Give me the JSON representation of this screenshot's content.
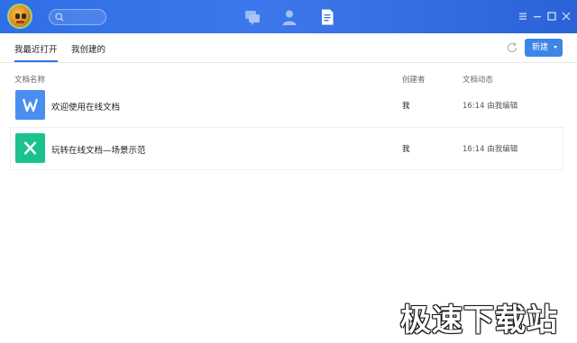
{
  "colors": {
    "titlebar": "#2f6fe6",
    "accent": "#2d73e8",
    "button": "#3d86e8",
    "word_icon": "#4a8ff0",
    "sheet_icon": "#1cc28e"
  },
  "titlebar": {
    "avatar_icon": "user-avatar",
    "search_placeholder": "",
    "nav_icons": [
      "chat-icon",
      "contacts-icon",
      "document-icon"
    ],
    "active_nav": "document-icon",
    "window_controls": [
      "menu-icon",
      "minimize-icon",
      "maximize-icon",
      "close-icon"
    ]
  },
  "tabs": {
    "recent": "我最近打开",
    "created": "我创建的",
    "active": "recent"
  },
  "toolbar": {
    "new_label": "新建",
    "refresh_icon": "refresh-icon"
  },
  "table": {
    "headers": {
      "name": "文档名称",
      "creator": "创建者",
      "activity": "文档动态"
    },
    "rows": [
      {
        "icon": "W",
        "icon_type": "word-doc-icon",
        "title": "欢迎使用在线文档",
        "creator": "我",
        "activity": "16:14 由我编辑"
      },
      {
        "icon": "X",
        "icon_type": "sheet-doc-icon",
        "title": "玩转在线文档—场景示范",
        "creator": "我",
        "activity": "16:14 由我编辑"
      }
    ]
  },
  "watermark": "极速下载站"
}
